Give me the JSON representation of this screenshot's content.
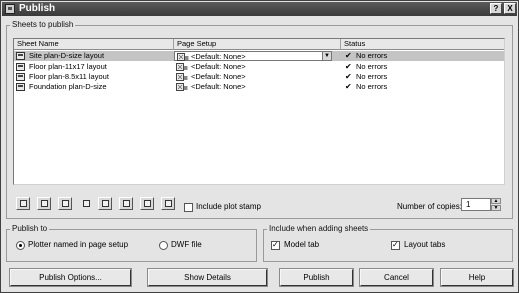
{
  "window": {
    "title": "Publish"
  },
  "titlebar": {
    "help_label": "?",
    "close_label": "X"
  },
  "sheets_group": {
    "label": "Sheets to publish"
  },
  "table": {
    "columns": [
      "Sheet Name",
      "Page Setup",
      "Status"
    ],
    "rows": [
      {
        "sheet": "Site plan-D-size layout",
        "setup": "<Default: None>",
        "status": "No errors",
        "selected": true
      },
      {
        "sheet": "Floor plan-11x17 layout",
        "setup": "<Default: None>",
        "status": "No errors",
        "selected": false
      },
      {
        "sheet": "Floor plan-8.5x11 layout",
        "setup": "<Default: None>",
        "status": "No errors",
        "selected": false
      },
      {
        "sheet": "Foundation plan-D-size",
        "setup": "<Default: None>",
        "status": "No errors",
        "selected": false
      }
    ]
  },
  "toolbar": {
    "icons": [
      "preview-icon",
      "add-sheets-icon",
      "remove-sheets-icon",
      "move-up-icon",
      "move-down-icon",
      "load-list-icon",
      "save-list-icon",
      "plot-stamp-settings-icon"
    ],
    "include_plot_stamp_label": "Include plot stamp",
    "include_plot_stamp_checked": false,
    "copies_label": "Number of copies:",
    "copies_value": "1"
  },
  "publish_to": {
    "label": "Publish to",
    "option_plotter": "Plotter named in page setup",
    "option_dwf": "DWF file",
    "selected": "plotter"
  },
  "include_sheets": {
    "label": "Include when adding sheets",
    "model_tab_label": "Model tab",
    "model_tab_checked": true,
    "layout_tabs_label": "Layout tabs",
    "layout_tabs_checked": true
  },
  "buttons": {
    "publish_options": "Publish Options...",
    "show_details": "Show Details",
    "publish": "Publish",
    "cancel": "Cancel",
    "help": "Help"
  }
}
